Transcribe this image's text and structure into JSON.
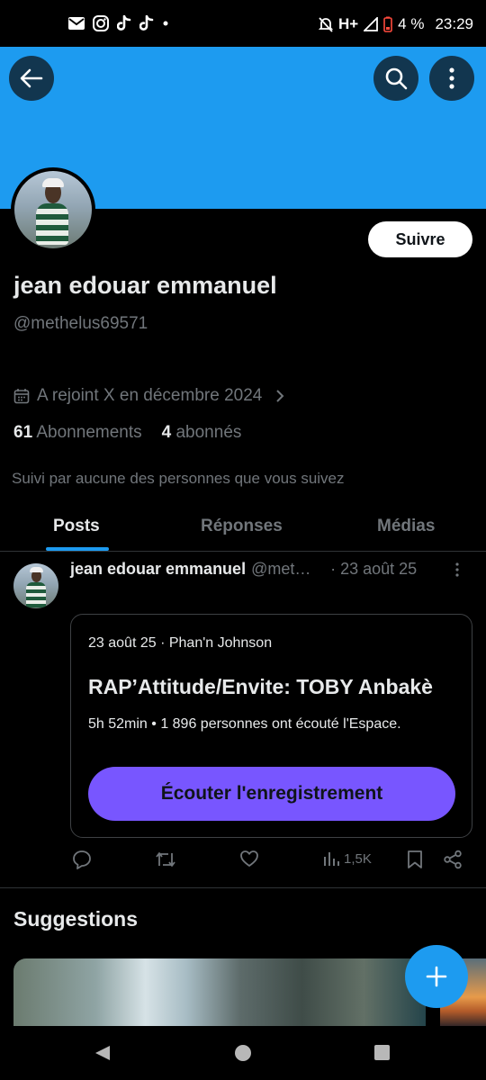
{
  "status_bar": {
    "network": "H+",
    "battery": "4 %",
    "time": "23:29"
  },
  "profile": {
    "name": "jean edouar emmanuel",
    "handle": "@methelus69571",
    "joined": "A rejoint X en décembre 2024",
    "following_count": "61",
    "following_label": "Abonnements",
    "followers_count": "4",
    "followers_label": "abonnés",
    "followed_by": "Suivi par aucune des personnes que vous suivez",
    "follow_button": "Suivre"
  },
  "tabs": [
    {
      "label": "Posts",
      "active": true
    },
    {
      "label": "Réponses",
      "active": false
    },
    {
      "label": "Médias",
      "active": false
    }
  ],
  "post": {
    "author_name": "jean edouar emmanuel",
    "author_handle": "@met…",
    "date": "· 23 août 25",
    "space_card": {
      "meta": "23 août 25 · Phan'n Johnson",
      "title": "RAP’Attitude/Envite: TOBY Anbakè",
      "info": "5h 52min • 1 896 personnes ont écouté l'Espace.",
      "button": "Écouter l'enregistrement",
      "button_color": "#7856ff"
    },
    "views": "1,5K"
  },
  "suggestions": {
    "title": "Suggestions"
  },
  "colors": {
    "accent": "#1d9bf0",
    "background": "#000000",
    "muted_text": "#71767b"
  }
}
